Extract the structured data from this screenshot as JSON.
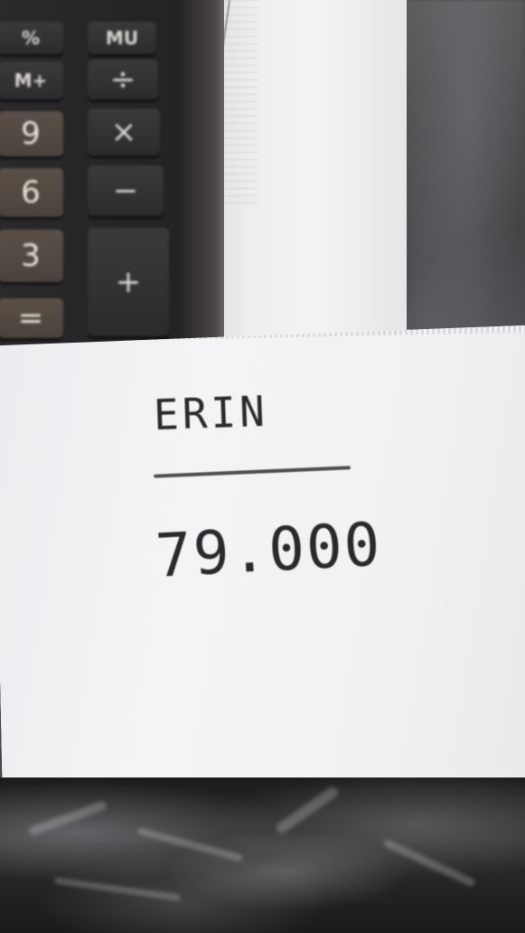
{
  "calculator": {
    "keys": {
      "percent": "%",
      "mu": "MU",
      "m_plus": "M+",
      "divide": "÷",
      "nine": "9",
      "multiply": "×",
      "six": "6",
      "minus": "−",
      "three": "3",
      "plus": "+",
      "equals": "="
    }
  },
  "receipt": {
    "name": "ERIN",
    "amount": "79.000"
  },
  "colors": {
    "calculator_body": "#2a2a2c",
    "number_keys": "#4a423c",
    "paper": "#f1f1f3",
    "ink": "#2a2a2e"
  }
}
